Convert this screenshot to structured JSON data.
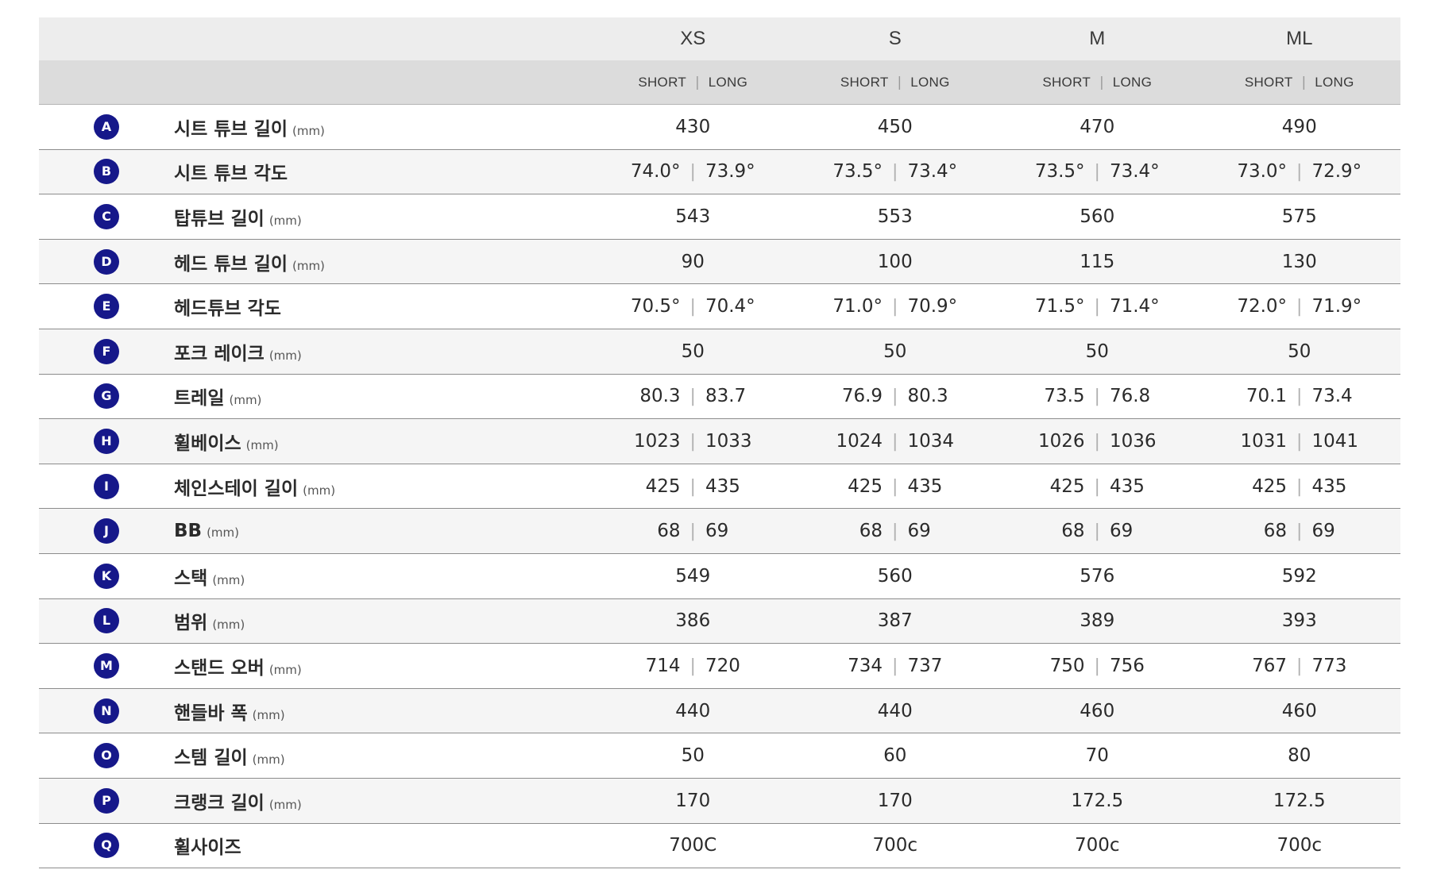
{
  "table": {
    "sizes": [
      "XS",
      "S",
      "M",
      "ML"
    ],
    "sub_short": "SHORT",
    "sub_long": "LONG",
    "sub_separator": "|",
    "value_separator": "|",
    "rows": [
      {
        "letter": "A",
        "label": "시트 튜브 길이",
        "unit": "(mm)",
        "values": [
          [
            "430"
          ],
          [
            "450"
          ],
          [
            "470"
          ],
          [
            "490"
          ]
        ]
      },
      {
        "letter": "B",
        "label": "시트 튜브 각도",
        "unit": "",
        "values": [
          [
            "74.0°",
            "73.9°"
          ],
          [
            "73.5°",
            "73.4°"
          ],
          [
            "73.5°",
            "73.4°"
          ],
          [
            "73.0°",
            "72.9°"
          ]
        ]
      },
      {
        "letter": "C",
        "label": "탑튜브 길이",
        "unit": "(mm)",
        "values": [
          [
            "543"
          ],
          [
            "553"
          ],
          [
            "560"
          ],
          [
            "575"
          ]
        ]
      },
      {
        "letter": "D",
        "label": "헤드 튜브 길이",
        "unit": "(mm)",
        "values": [
          [
            "90"
          ],
          [
            "100"
          ],
          [
            "115"
          ],
          [
            "130"
          ]
        ]
      },
      {
        "letter": "E",
        "label": "헤드튜브 각도",
        "unit": "",
        "values": [
          [
            "70.5°",
            "70.4°"
          ],
          [
            "71.0°",
            "70.9°"
          ],
          [
            "71.5°",
            "71.4°"
          ],
          [
            "72.0°",
            "71.9°"
          ]
        ]
      },
      {
        "letter": "F",
        "label": "포크 레이크",
        "unit": "(mm)",
        "values": [
          [
            "50"
          ],
          [
            "50"
          ],
          [
            "50"
          ],
          [
            "50"
          ]
        ]
      },
      {
        "letter": "G",
        "label": "트레일",
        "unit": "(mm)",
        "values": [
          [
            "80.3",
            "83.7"
          ],
          [
            "76.9",
            "80.3"
          ],
          [
            "73.5",
            "76.8"
          ],
          [
            "70.1",
            "73.4"
          ]
        ]
      },
      {
        "letter": "H",
        "label": "휠베이스",
        "unit": "(mm)",
        "values": [
          [
            "1023",
            "1033"
          ],
          [
            "1024",
            "1034"
          ],
          [
            "1026",
            "1036"
          ],
          [
            "1031",
            "1041"
          ]
        ]
      },
      {
        "letter": "I",
        "label": "체인스테이 길이",
        "unit": "(mm)",
        "values": [
          [
            "425",
            "435"
          ],
          [
            "425",
            "435"
          ],
          [
            "425",
            "435"
          ],
          [
            "425",
            "435"
          ]
        ]
      },
      {
        "letter": "J",
        "label": "BB",
        "unit": "(mm)",
        "values": [
          [
            "68",
            "69"
          ],
          [
            "68",
            "69"
          ],
          [
            "68",
            "69"
          ],
          [
            "68",
            "69"
          ]
        ]
      },
      {
        "letter": "K",
        "label": "스택",
        "unit": "(mm)",
        "values": [
          [
            "549"
          ],
          [
            "560"
          ],
          [
            "576"
          ],
          [
            "592"
          ]
        ]
      },
      {
        "letter": "L",
        "label": "범위",
        "unit": "(mm)",
        "values": [
          [
            "386"
          ],
          [
            "387"
          ],
          [
            "389"
          ],
          [
            "393"
          ]
        ]
      },
      {
        "letter": "M",
        "label": "스탠드 오버",
        "unit": "(mm)",
        "values": [
          [
            "714",
            "720"
          ],
          [
            "734",
            "737"
          ],
          [
            "750",
            "756"
          ],
          [
            "767",
            "773"
          ]
        ]
      },
      {
        "letter": "N",
        "label": "핸들바 폭",
        "unit": "(mm)",
        "values": [
          [
            "440"
          ],
          [
            "440"
          ],
          [
            "460"
          ],
          [
            "460"
          ]
        ]
      },
      {
        "letter": "O",
        "label": "스템 길이",
        "unit": "(mm)",
        "values": [
          [
            "50"
          ],
          [
            "60"
          ],
          [
            "70"
          ],
          [
            "80"
          ]
        ]
      },
      {
        "letter": "P",
        "label": "크랭크 길이",
        "unit": "(mm)",
        "values": [
          [
            "170"
          ],
          [
            "170"
          ],
          [
            "172.5"
          ],
          [
            "172.5"
          ]
        ]
      },
      {
        "letter": "Q",
        "label": "휠사이즈",
        "unit": "",
        "values": [
          [
            "700C"
          ],
          [
            "700c"
          ],
          [
            "700c"
          ],
          [
            "700c"
          ]
        ]
      }
    ]
  },
  "colors": {
    "badge": "#16188a",
    "header_top": "#ededed",
    "header_sub": "#dcdcdc",
    "row_alt": "#f5f5f5"
  }
}
